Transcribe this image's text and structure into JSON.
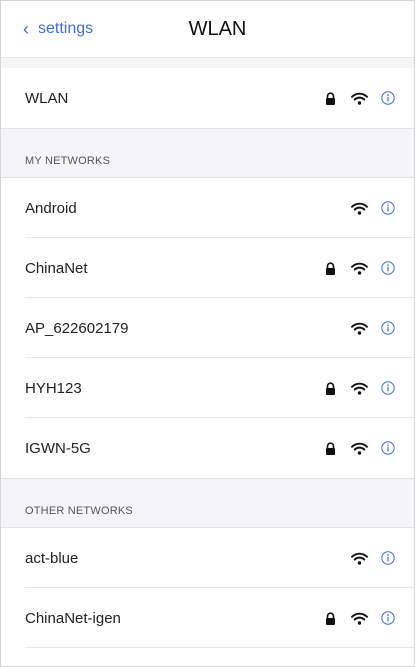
{
  "header": {
    "back_label": "settings",
    "title": "WLAN"
  },
  "wlan_toggle_row": {
    "label": "WLAN",
    "secured": true
  },
  "sections": [
    {
      "title": "MY NETWORKS",
      "networks": [
        {
          "name": "Android",
          "secured": false
        },
        {
          "name": "ChinaNet",
          "secured": true
        },
        {
          "name": "AP_622602179",
          "secured": false
        },
        {
          "name": "HYH123",
          "secured": true
        },
        {
          "name": "IGWN-5G",
          "secured": true
        }
      ]
    },
    {
      "title": "OTHER NETWORKS",
      "networks": [
        {
          "name": "act-blue",
          "secured": false
        },
        {
          "name": "ChinaNet-igen",
          "secured": true
        }
      ]
    }
  ],
  "icons": {
    "back": "chevron-left-icon",
    "lock": "lock-icon",
    "wifi": "wifi-icon",
    "info": "info-icon"
  },
  "colors": {
    "accent": "#3b6fd6",
    "icon": "#111111",
    "section_bg": "#f5f5f7",
    "separator": "#e7e7e7"
  }
}
